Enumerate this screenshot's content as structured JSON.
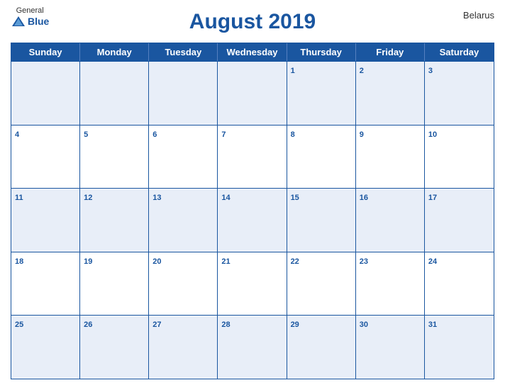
{
  "header": {
    "title": "August 2019",
    "country": "Belarus",
    "logo_general": "General",
    "logo_blue": "Blue"
  },
  "days_of_week": [
    "Sunday",
    "Monday",
    "Tuesday",
    "Wednesday",
    "Thursday",
    "Friday",
    "Saturday"
  ],
  "weeks": [
    [
      {
        "day": "",
        "empty": true
      },
      {
        "day": "",
        "empty": true
      },
      {
        "day": "",
        "empty": true
      },
      {
        "day": "",
        "empty": true
      },
      {
        "day": "1"
      },
      {
        "day": "2"
      },
      {
        "day": "3"
      }
    ],
    [
      {
        "day": "4"
      },
      {
        "day": "5"
      },
      {
        "day": "6"
      },
      {
        "day": "7"
      },
      {
        "day": "8"
      },
      {
        "day": "9"
      },
      {
        "day": "10"
      }
    ],
    [
      {
        "day": "11"
      },
      {
        "day": "12"
      },
      {
        "day": "13"
      },
      {
        "day": "14"
      },
      {
        "day": "15"
      },
      {
        "day": "16"
      },
      {
        "day": "17"
      }
    ],
    [
      {
        "day": "18"
      },
      {
        "day": "19"
      },
      {
        "day": "20"
      },
      {
        "day": "21"
      },
      {
        "day": "22"
      },
      {
        "day": "23"
      },
      {
        "day": "24"
      }
    ],
    [
      {
        "day": "25"
      },
      {
        "day": "26"
      },
      {
        "day": "27"
      },
      {
        "day": "28"
      },
      {
        "day": "29"
      },
      {
        "day": "30"
      },
      {
        "day": "31"
      }
    ]
  ],
  "colors": {
    "header_bg": "#1a56a0",
    "accent": "#1a56a0",
    "odd_row": "#dce6f5",
    "even_row": "#ffffff",
    "border": "#1a56a0"
  }
}
